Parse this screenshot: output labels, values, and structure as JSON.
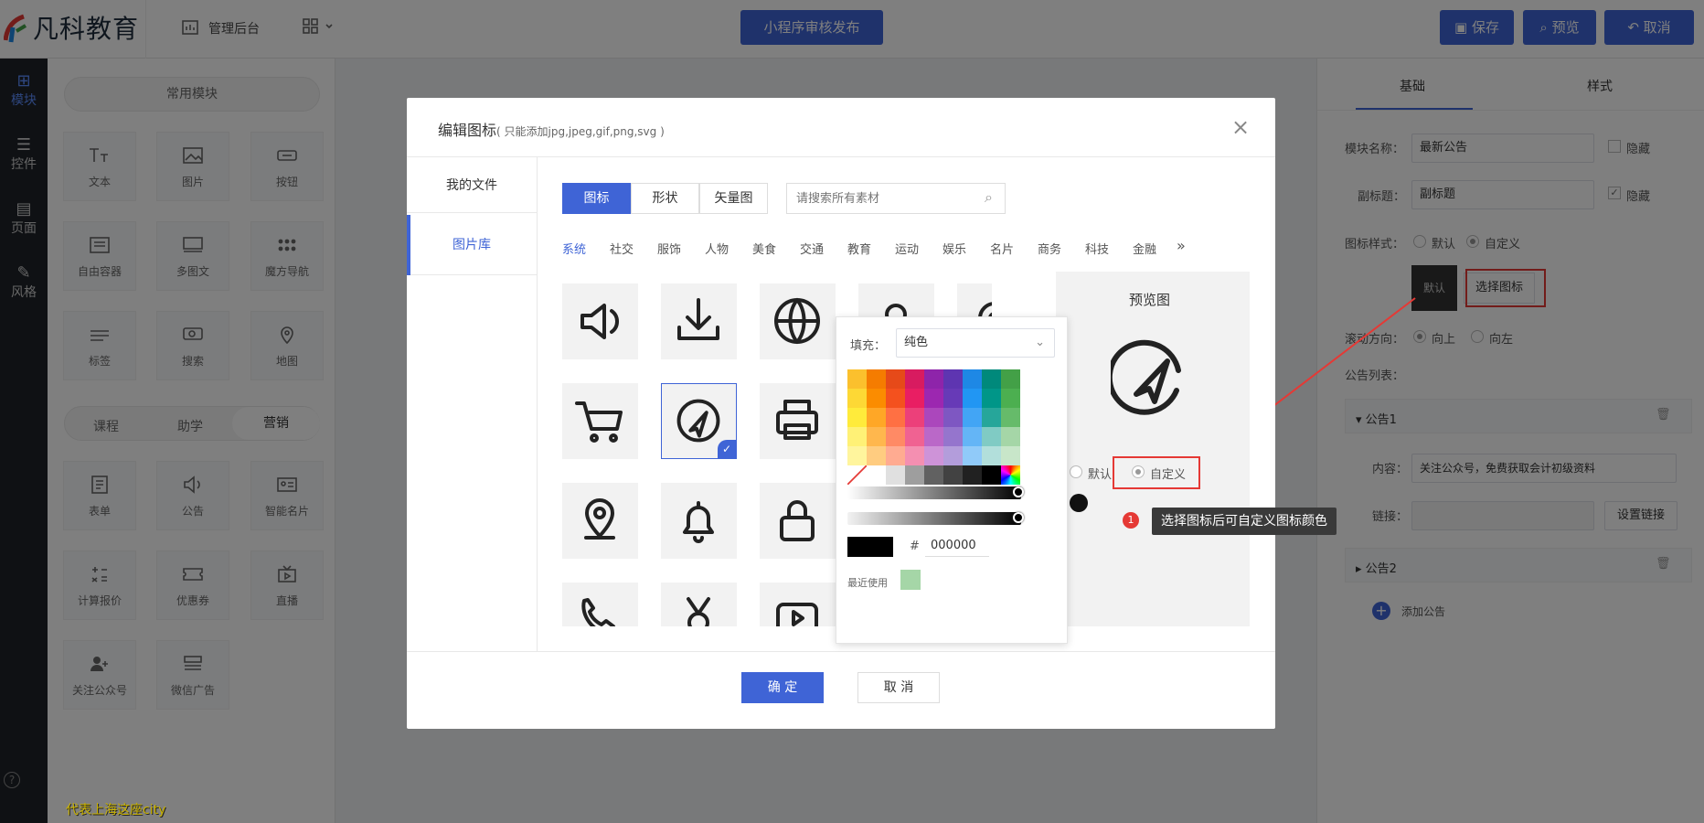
{
  "header": {
    "logo": "凡科教育",
    "admin": "管理后台",
    "center_button": "小程序审核发布",
    "save": "保存",
    "preview": "预览",
    "cancel": "取消"
  },
  "leftbar": {
    "items": [
      "模块",
      "控件",
      "页面",
      "风格"
    ]
  },
  "modules": {
    "common_tab": "常用模块",
    "group1": [
      "文本",
      "图片",
      "按钮",
      "自由容器",
      "多图文",
      "魔方导航",
      "标签",
      "搜索",
      "地图"
    ],
    "subtabs": [
      "课程",
      "助学",
      "营销"
    ],
    "group2": [
      "表单",
      "公告",
      "智能名片",
      "计算报价",
      "优惠券",
      "直播",
      "关注公众号",
      "微信广告"
    ]
  },
  "right": {
    "tabs": [
      "基础",
      "样式"
    ],
    "module_name_label": "模块名称：",
    "module_name_value": "最新公告",
    "hide1": "隐藏",
    "subtitle_label": "副标题：",
    "subtitle_value": "副标题",
    "hide2": "隐藏",
    "icon_style_label": "图标样式：",
    "icon_style_opt1": "默认",
    "icon_style_opt2": "自定义",
    "default_icon": "默认",
    "choose_icon": "选择图标",
    "scroll_label": "滚动方向：",
    "scroll_up": "向上",
    "scroll_left": "向左",
    "list_label": "公告列表：",
    "notice1": "公告1",
    "content_label": "内容：",
    "content_value": "关注公众号，免费获取会计初级资料",
    "link_label": "链接：",
    "set_link": "设置链接",
    "notice2": "公告2",
    "add_notice": "添加公告"
  },
  "modal": {
    "title": "编辑图标",
    "hint": "( 只能添加jpg,jpeg,gif,png,svg )",
    "nav": [
      "我的文件",
      "图片库"
    ],
    "type_tabs": [
      "图标",
      "形状",
      "矢量图"
    ],
    "search_placeholder": "请搜索所有素材",
    "categories": [
      "系统",
      "社交",
      "服饰",
      "人物",
      "美食",
      "交通",
      "教育",
      "运动",
      "娱乐",
      "名片",
      "商务",
      "科技",
      "金融"
    ],
    "more": "»",
    "preview_title": "预览图",
    "radio_default": "默认",
    "radio_custom": "自定义",
    "tooltip_num": "1",
    "tooltip": "选择图标后可自定义图标颜色",
    "ok": "确 定",
    "cancel": "取 消"
  },
  "picker": {
    "fill_label": "填充：",
    "fill_value": "纯色",
    "hash": "#",
    "hex": "000000",
    "recent_label": "最近使用"
  },
  "watermark": "代表上海这座city",
  "colors": {
    "primary": "#3f64d6",
    "red": "#e53935"
  }
}
